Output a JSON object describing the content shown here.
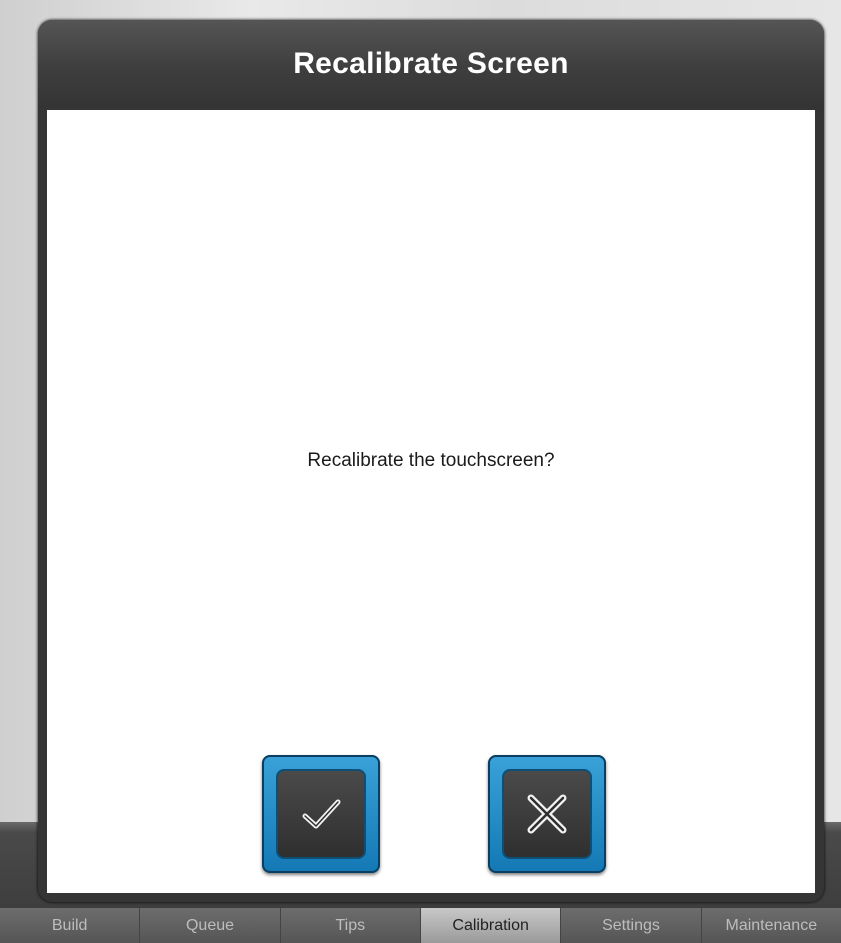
{
  "dialog": {
    "title": "Recalibrate Screen",
    "prompt": "Recalibrate the touchscreen?",
    "confirm_icon": "checkmark-icon",
    "cancel_icon": "close-icon"
  },
  "tabs": [
    {
      "label": "Build",
      "active": false
    },
    {
      "label": "Queue",
      "active": false
    },
    {
      "label": "Tips",
      "active": false
    },
    {
      "label": "Calibration",
      "active": true
    },
    {
      "label": "Settings",
      "active": false
    },
    {
      "label": "Maintenance",
      "active": false
    }
  ],
  "colors": {
    "accent": "#1e8ccd",
    "header": "#3e3e3e"
  }
}
